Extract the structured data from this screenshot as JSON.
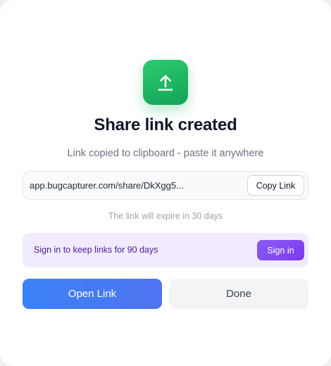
{
  "dialog": {
    "title": "Share link created",
    "subtitle": "Link copied to clipboard - paste it anywhere",
    "icon": "upload-arrow-icon",
    "accent_green": "#1fb864"
  },
  "link": {
    "url": "app.bugcapturer.com/share/DkXgg5...",
    "copy_label": "Copy Link"
  },
  "expiry_text": "The link will expire in 30 days",
  "signin_banner": {
    "text": "Sign in to keep links for 90 days",
    "button_label": "Sign in",
    "accent": "#7c3aed"
  },
  "actions": {
    "open_label": "Open Link",
    "done_label": "Done",
    "primary_color": "#3b82f6"
  }
}
